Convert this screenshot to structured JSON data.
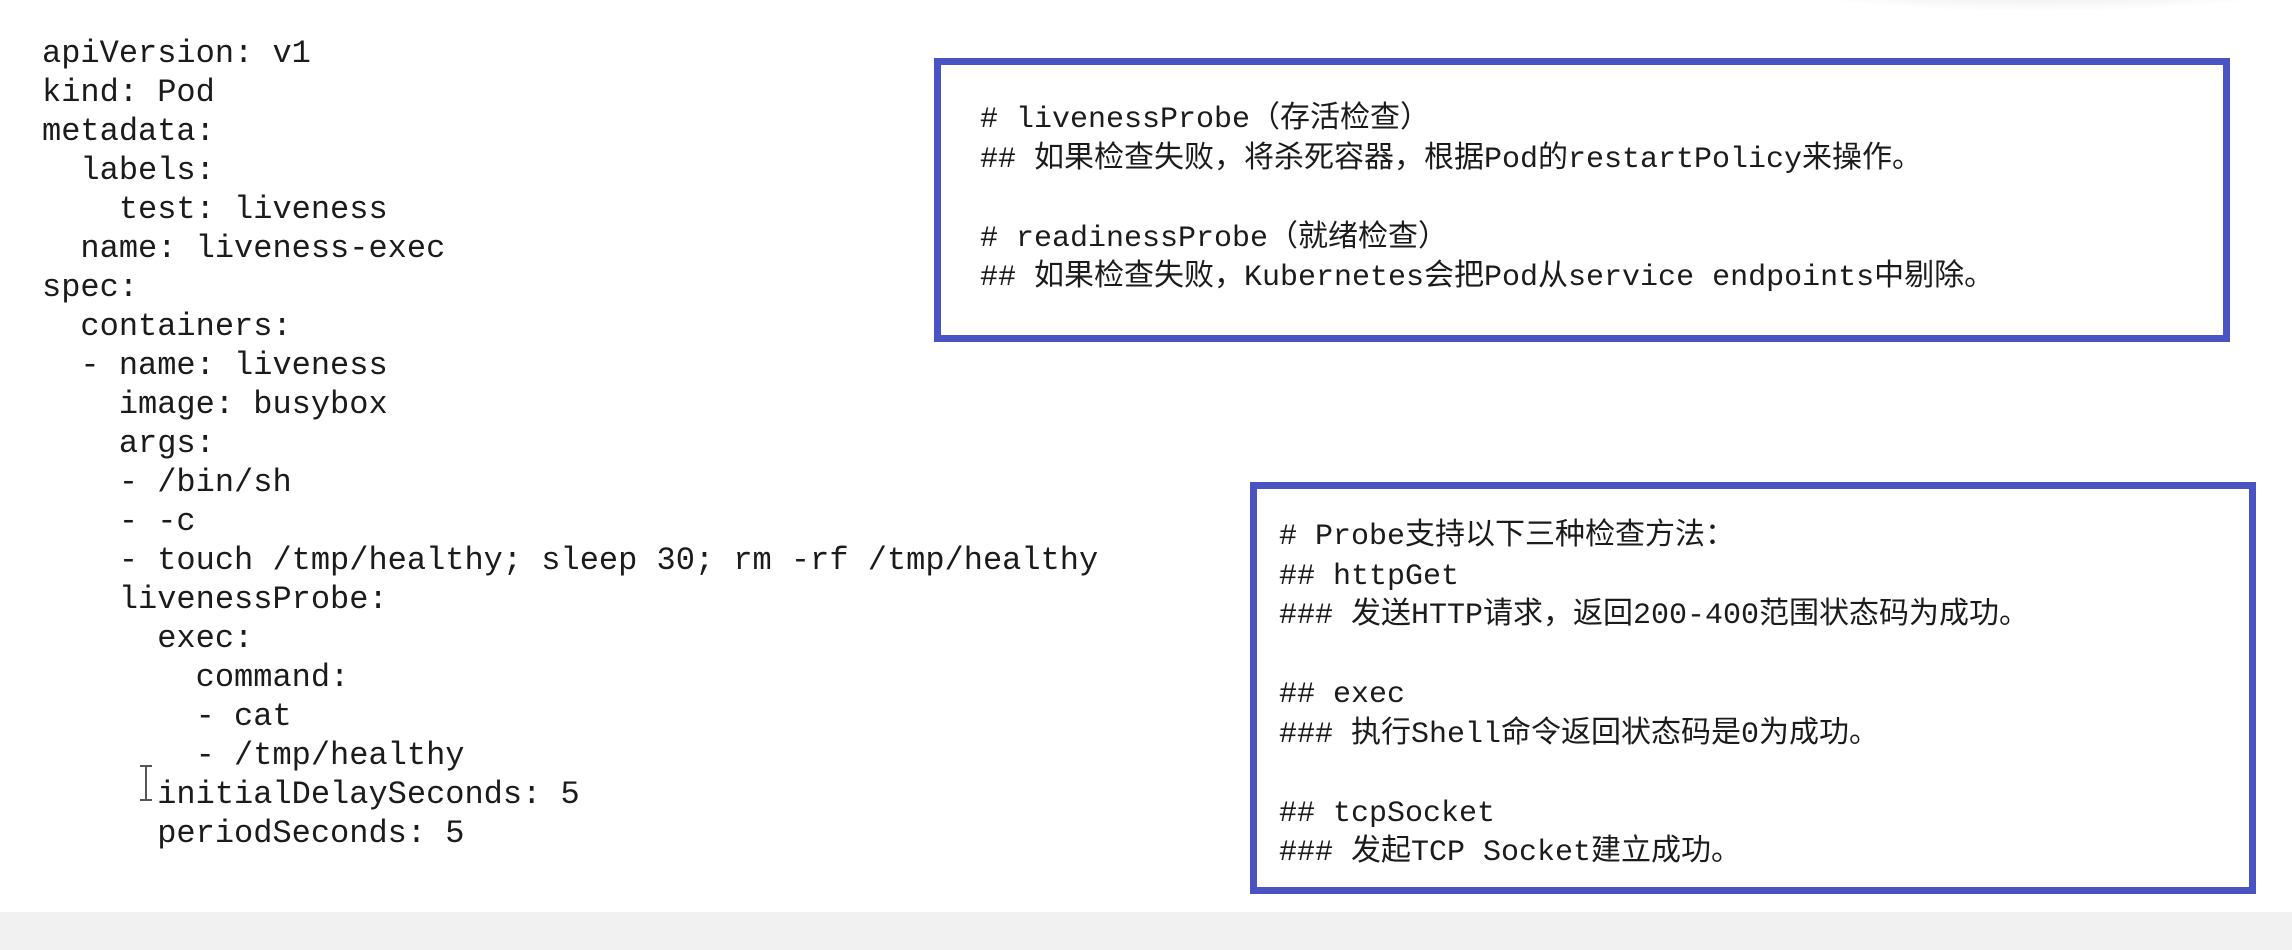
{
  "yaml_code": {
    "lines": [
      "apiVersion: v1",
      "kind: Pod",
      "metadata:",
      "  labels:",
      "    test: liveness",
      "  name: liveness-exec",
      "spec:",
      "  containers:",
      "  - name: liveness",
      "    image: busybox",
      "    args:",
      "    - /bin/sh",
      "    - -c",
      "    - touch /tmp/healthy; sleep 30; rm -rf /tmp/healthy",
      "    livenessProbe:",
      "      exec:",
      "        command:",
      "        - cat",
      "        - /tmp/healthy",
      "      initialDelaySeconds: 5",
      "      periodSeconds: 5"
    ]
  },
  "probe_types_box": {
    "liveness_heading": "# livenessProbe（存活检查）",
    "liveness_desc": "## 如果检查失败，将杀死容器，根据Pod的restartPolicy来操作。",
    "readiness_heading": "# readinessProbe（就绪检查）",
    "readiness_desc": "## 如果检查失败，Kubernetes会把Pod从service endpoints中剔除。"
  },
  "probe_methods_box": {
    "heading": "# Probe支持以下三种检查方法：",
    "httpget_title": "## httpGet",
    "httpget_desc": "### 发送HTTP请求，返回200-400范围状态码为成功。",
    "exec_title": "## exec",
    "exec_desc": "### 执行Shell命令返回状态码是0为成功。",
    "tcpsocket_title": "## tcpSocket",
    "tcpsocket_desc": "### 发起TCP Socket建立成功。"
  },
  "colors": {
    "box_border": "#4a53c4",
    "text": "#1b1b1b",
    "background": "#ffffff"
  },
  "icons": {
    "cursor": "text-cursor-icon"
  }
}
